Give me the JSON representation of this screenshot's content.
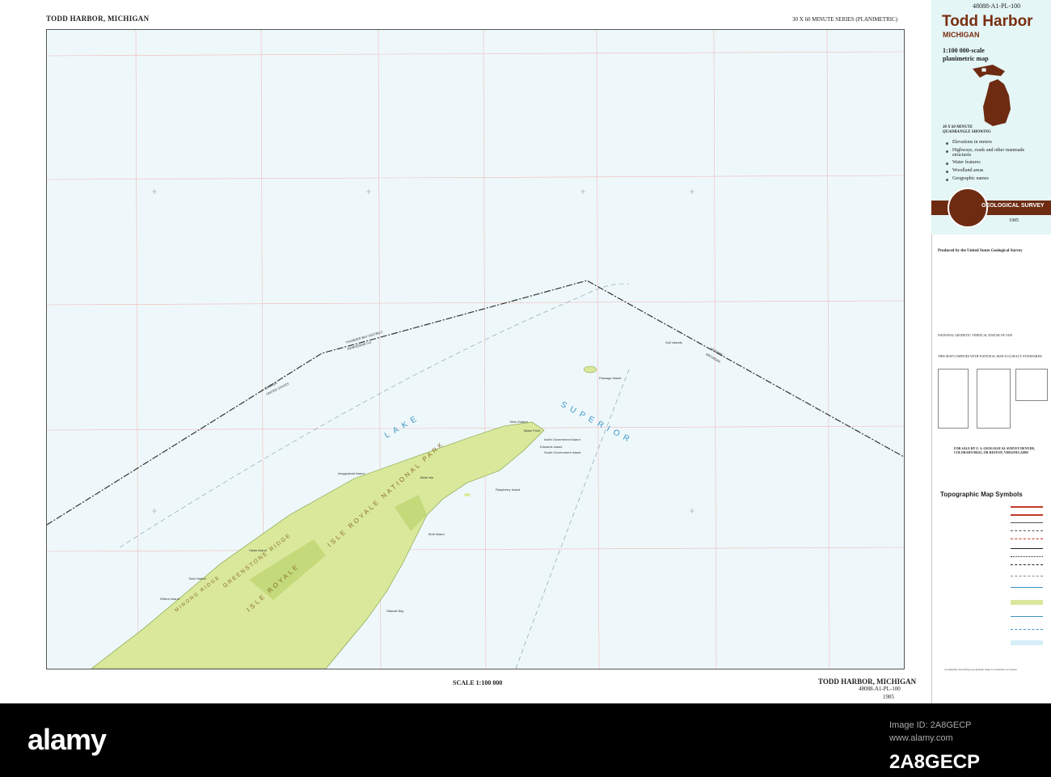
{
  "map": {
    "header_left": "TODD HARBOR, MICHIGAN",
    "header_right": "30 X 60 MINUTE SERIES (PLANIMETRIC)",
    "footer_name": "TODD HARBOR, MICHIGAN",
    "footer_code": "48088-A1-PL-100",
    "footer_year": "1985",
    "scale": "SCALE 1:100 000",
    "sheet_id": "48088-A1-PL-100",
    "water_labels": [
      "LAKE",
      "SUPERIOR"
    ],
    "park_labels": [
      "ISLE ROYALE NATIONAL PARK",
      "ISLE ROYALE",
      "GREENSTONE RIDGE",
      "MINONG RIDGE"
    ],
    "boundary_labels": [
      "THUNDER BAY DISTRICT",
      "KEWEENAW CO",
      "CANADA",
      "UNITED STATES",
      "ONTARIO",
      "MICHIGAN"
    ],
    "place_labels": [
      "Tobin Harbor",
      "Blake Point",
      "North Government Island",
      "Edwards Island",
      "South Government Island",
      "Amygdaloid Island",
      "Belle Isle",
      "Raspberry Island",
      "Passage Island",
      "Gull Islands",
      "Todd Harbor",
      "Wilson Island",
      "Hawk Island",
      "Mott Island",
      "Siskiwit Bay"
    ]
  },
  "panel": {
    "title": "Todd Harbor",
    "state": "MICHIGAN",
    "scale_line1": "1:100 000-scale",
    "scale_line2": "planimetric map",
    "quad_desc": "30 X 60 MINUTE QUADRANGLE SHOWING",
    "features": [
      "Elevations in meters",
      "Highways, roads and other manmade structures",
      "Water features",
      "Woodland areas",
      "Geographic names"
    ],
    "agency": "GEOLOGICAL SURVEY",
    "year": "1985",
    "produced_by": "Produced by the United States Geological Survey",
    "datum_note": "NATIONAL GEODETIC VERTICAL DATUM OF 1929",
    "accuracy_note": "THIS MAP COMPLIES WITH NATIONAL MAP ACCURACY STANDARDS",
    "sale_note": "FOR SALE BY U. S. GEOLOGICAL SURVEY DENVER, COLORADO 80225, OR RESTON, VIRGINIA 22092",
    "legend_title": "Topographic Map Symbols",
    "pamphlet": "A pamphlet describing topographic maps is available on request"
  },
  "stock": {
    "brand": "alamy",
    "image_id": "Image ID: 2A8GECP",
    "url": "www.alamy.com",
    "code": "2A8GECP"
  },
  "colors": {
    "land": "#d9e89a",
    "water": "#eef8fb",
    "brown": "#6e2b12",
    "water_text": "#3a93c4"
  }
}
